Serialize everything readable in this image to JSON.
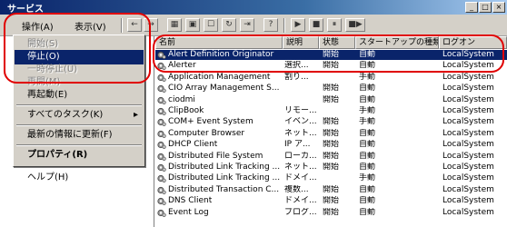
{
  "window": {
    "title": "サービス",
    "buttons": [
      "_",
      "□",
      "×"
    ]
  },
  "menubar": {
    "action": "操作(A)",
    "view": "表示(V)"
  },
  "toolbar": {
    "back": "←",
    "forward": "→",
    "play": "▶",
    "stop": "■",
    "pause": "⏸",
    "restart": "■▶"
  },
  "context_menu": {
    "items": [
      {
        "label": "開始(S)",
        "state": "disabled"
      },
      {
        "label": "停止(O)",
        "state": "selected"
      },
      {
        "label": "一時停止(U)",
        "state": "disabled"
      },
      {
        "label": "再開(M)",
        "state": "disabled"
      },
      {
        "label": "再起動(E)",
        "state": "normal"
      },
      {
        "label": "すべてのタスク(K)",
        "state": "submenu"
      },
      {
        "label": "最新の情報に更新(F)",
        "state": "normal"
      },
      {
        "label": "プロパティ(R)",
        "state": "bold"
      },
      {
        "label": "ヘルプ(H)",
        "state": "normal"
      }
    ]
  },
  "table": {
    "columns": [
      "名前",
      "説明",
      "状態",
      "スタートアップの種類",
      "ログオン"
    ],
    "rows": [
      {
        "name": "Alert Definition Originator",
        "desc": "",
        "status": "開始",
        "startup": "自動",
        "logon": "LocalSystem",
        "selected": true
      },
      {
        "name": "Alerter",
        "desc": "選択...",
        "status": "開始",
        "startup": "自動",
        "logon": "LocalSystem"
      },
      {
        "name": "Application Management",
        "desc": "割り...",
        "status": "",
        "startup": "手動",
        "logon": "LocalSystem"
      },
      {
        "name": "CIO Array Management S...",
        "desc": "",
        "status": "開始",
        "startup": "自動",
        "logon": "LocalSystem"
      },
      {
        "name": "ciodmi",
        "desc": "",
        "status": "開始",
        "startup": "自動",
        "logon": "LocalSystem"
      },
      {
        "name": "ClipBook",
        "desc": "リモー...",
        "status": "",
        "startup": "手動",
        "logon": "LocalSystem"
      },
      {
        "name": "COM+ Event System",
        "desc": "イベン...",
        "status": "開始",
        "startup": "手動",
        "logon": "LocalSystem"
      },
      {
        "name": "Computer Browser",
        "desc": "ネット...",
        "status": "開始",
        "startup": "自動",
        "logon": "LocalSystem"
      },
      {
        "name": "DHCP Client",
        "desc": "IP ア...",
        "status": "開始",
        "startup": "自動",
        "logon": "LocalSystem"
      },
      {
        "name": "Distributed File System",
        "desc": "ローカ...",
        "status": "開始",
        "startup": "自動",
        "logon": "LocalSystem"
      },
      {
        "name": "Distributed Link Tracking ...",
        "desc": "ネット...",
        "status": "開始",
        "startup": "自動",
        "logon": "LocalSystem"
      },
      {
        "name": "Distributed Link Tracking ...",
        "desc": "ドメイ...",
        "status": "",
        "startup": "手動",
        "logon": "LocalSystem"
      },
      {
        "name": "Distributed Transaction C...",
        "desc": "複数...",
        "status": "開始",
        "startup": "自動",
        "logon": "LocalSystem"
      },
      {
        "name": "DNS Client",
        "desc": "ドメイ...",
        "status": "開始",
        "startup": "自動",
        "logon": "LocalSystem"
      },
      {
        "name": "Event Log",
        "desc": "ブログ...",
        "status": "開始",
        "startup": "自動",
        "logon": "LocalSystem"
      }
    ]
  },
  "colors": {
    "highlight": "#0a246a",
    "annotation": "#e00000"
  }
}
